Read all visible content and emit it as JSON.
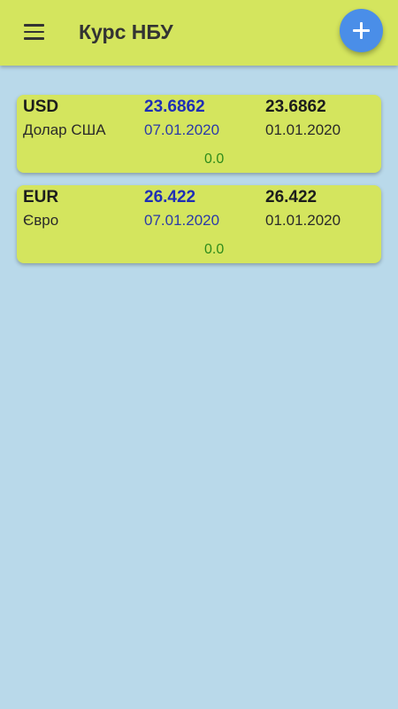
{
  "appbar": {
    "title": "Курс НБУ",
    "menu_icon": "menu-icon",
    "add_icon": "plus-icon"
  },
  "colors": {
    "background": "#b9d9ea",
    "appbar": "#d4e55e",
    "card": "#d4e55e",
    "fab": "#4a8ee8",
    "current_rate": "#1f2fb5",
    "change": "#2e8b1a"
  },
  "currencies": [
    {
      "code": "USD",
      "name": "Долар США",
      "current_rate": "23.6862",
      "current_date": "07.01.2020",
      "base_rate": "23.6862",
      "base_date": "01.01.2020",
      "change": "0.0"
    },
    {
      "code": "EUR",
      "name": "Євро",
      "current_rate": "26.422",
      "current_date": "07.01.2020",
      "base_rate": "26.422",
      "base_date": "01.01.2020",
      "change": "0.0"
    }
  ]
}
